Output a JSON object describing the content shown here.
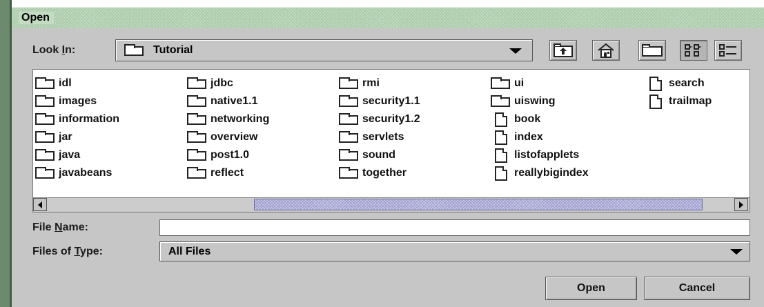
{
  "window": {
    "title": "Open"
  },
  "lookin": {
    "label_pre": "Look ",
    "label_key": "I",
    "label_post": "n:",
    "value": "Tutorial"
  },
  "toolbar": {
    "up_icon": "up-folder-icon",
    "home_icon": "home-icon",
    "new_folder_icon": "new-folder-icon",
    "list_icon": "list-view-icon",
    "details_icon": "details-view-icon"
  },
  "files": [
    {
      "name": "idl",
      "type": "folder"
    },
    {
      "name": "images",
      "type": "folder"
    },
    {
      "name": "information",
      "type": "folder"
    },
    {
      "name": "jar",
      "type": "folder"
    },
    {
      "name": "java",
      "type": "folder"
    },
    {
      "name": "javabeans",
      "type": "folder"
    },
    {
      "name": "jdbc",
      "type": "folder"
    },
    {
      "name": "native1.1",
      "type": "folder"
    },
    {
      "name": "networking",
      "type": "folder"
    },
    {
      "name": "overview",
      "type": "folder"
    },
    {
      "name": "post1.0",
      "type": "folder"
    },
    {
      "name": "reflect",
      "type": "folder"
    },
    {
      "name": "rmi",
      "type": "folder"
    },
    {
      "name": "security1.1",
      "type": "folder"
    },
    {
      "name": "security1.2",
      "type": "folder"
    },
    {
      "name": "servlets",
      "type": "folder"
    },
    {
      "name": "sound",
      "type": "folder"
    },
    {
      "name": "together",
      "type": "folder"
    },
    {
      "name": "ui",
      "type": "folder"
    },
    {
      "name": "uiswing",
      "type": "folder"
    },
    {
      "name": "book",
      "type": "file"
    },
    {
      "name": "index",
      "type": "file"
    },
    {
      "name": "listofapplets",
      "type": "file"
    },
    {
      "name": "reallybigindex",
      "type": "file"
    },
    {
      "name": "search",
      "type": "file"
    },
    {
      "name": "trailmap",
      "type": "file"
    }
  ],
  "filename": {
    "label_pre": "File ",
    "label_key": "N",
    "label_post": "ame:",
    "value": ""
  },
  "filetype": {
    "label_pre": "Files of ",
    "label_key": "T",
    "label_post": "ype:",
    "value": "All Files"
  },
  "buttons": {
    "open": "Open",
    "cancel": "Cancel"
  }
}
